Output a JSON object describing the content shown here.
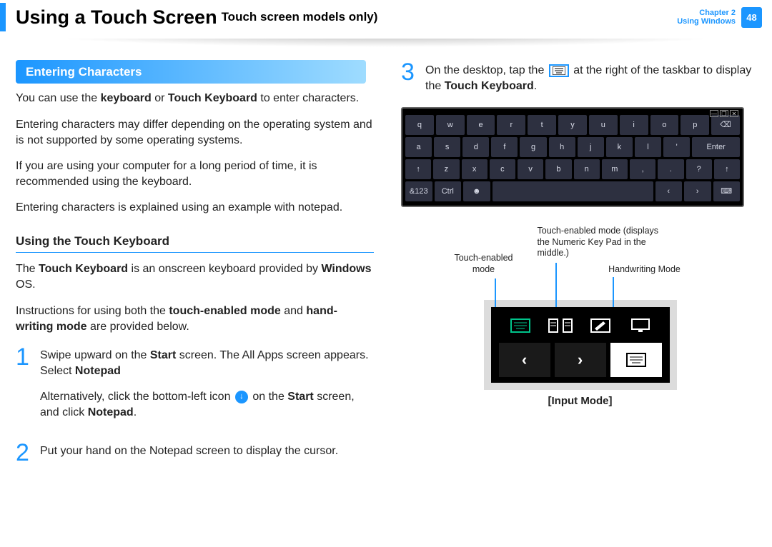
{
  "header": {
    "title": "Using a Touch Screen",
    "subtitle": "Touch screen models only)",
    "chapter": "Chapter 2",
    "section": "Using Windows",
    "page": "48"
  },
  "left": {
    "section_title": "Entering Characters",
    "p1a": "You can use the ",
    "p1b": "keyboard",
    "p1c": " or ",
    "p1d": "Touch Keyboard",
    "p1e": " to enter characters.",
    "p2": "Entering characters may differ depending on the operating system and is not supported by some operating systems.",
    "p3": "If you are using your computer for a long period of time, it is recommended using the keyboard.",
    "p4": "Entering characters is explained using an example with notepad.",
    "subhead": "Using the Touch Keyboard",
    "p5a": "The ",
    "p5b": "Touch Keyboard",
    "p5c": " is an onscreen keyboard provided by ",
    "p5d": "Windows",
    "p5e": " OS.",
    "p6a": "Instructions for using both the ",
    "p6b": "touch-enabled mode",
    "p6c": " and ",
    "p6d": "hand-writing mode",
    "p6e": " are provided below.",
    "step1_num": "1",
    "step1a": "Swipe upward on the ",
    "step1b": "Start",
    "step1c": " screen. The All Apps screen appears. Select ",
    "step1d": "Notepad",
    "step1alt_a": "Alternatively, click the bottom-left icon ",
    "step1alt_b": " on the ",
    "step1alt_c": "Start",
    "step1alt_d": " screen, and click ",
    "step1alt_e": "Notepad",
    "step1alt_f": ".",
    "step2_num": "2",
    "step2": "Put your hand on the Notepad screen to display the cursor."
  },
  "right": {
    "step3_num": "3",
    "step3a": "On the desktop, tap the ",
    "step3b": " at the right of the taskbar to display the ",
    "step3c": "Touch Keyboard",
    "step3d": ".",
    "callout1": "Touch-enabled mode",
    "callout2": "Touch-enabled mode (displays the Numeric Key Pad in the middle.)",
    "callout3": "Handwriting Mode",
    "input_mode": "[Input Mode]"
  },
  "keyboard": {
    "row1": [
      "q",
      "w",
      "e",
      "r",
      "t",
      "y",
      "u",
      "i",
      "o",
      "p",
      "⌫"
    ],
    "row2": [
      "a",
      "s",
      "d",
      "f",
      "g",
      "h",
      "j",
      "k",
      "l",
      "'",
      "Enter"
    ],
    "row3": [
      "↑",
      "z",
      "x",
      "c",
      "v",
      "b",
      "n",
      "m",
      ",",
      ".",
      "?",
      "↑"
    ],
    "row4": [
      "&123",
      "Ctrl",
      "☻",
      "",
      "",
      "‹",
      "›",
      "⌨"
    ]
  }
}
